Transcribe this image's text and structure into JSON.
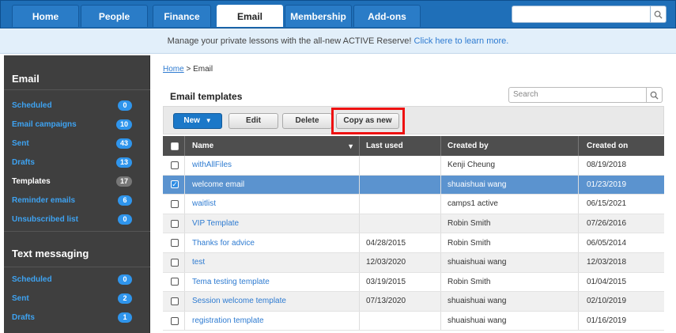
{
  "nav": {
    "tabs": [
      "Home",
      "People",
      "Finance",
      "Email",
      "Membership",
      "Add-ons"
    ],
    "active_tab": "Email",
    "search_value": ""
  },
  "banner": {
    "text": "Manage your private lessons with the all-new ACTIVE Reserve!",
    "link": "Click here to learn more."
  },
  "sidebar": {
    "email_heading": "Email",
    "email_items": [
      {
        "label": "Scheduled",
        "count": "0"
      },
      {
        "label": "Email campaigns",
        "count": "10"
      },
      {
        "label": "Sent",
        "count": "43"
      },
      {
        "label": "Drafts",
        "count": "13"
      },
      {
        "label": "Templates",
        "count": "17"
      },
      {
        "label": "Reminder emails",
        "count": "6"
      },
      {
        "label": "Unsubscribed list",
        "count": "0"
      }
    ],
    "text_heading": "Text messaging",
    "text_items": [
      {
        "label": "Scheduled",
        "count": "0"
      },
      {
        "label": "Sent",
        "count": "2"
      },
      {
        "label": "Drafts",
        "count": "1"
      }
    ]
  },
  "breadcrumb": {
    "home": "Home",
    "sep": ">",
    "current": "Email"
  },
  "main": {
    "title": "Email templates",
    "search_placeholder": "Search",
    "buttons": {
      "new": "New",
      "edit": "Edit",
      "delete": "Delete",
      "copy": "Copy as new"
    }
  },
  "table": {
    "headers": [
      "Name",
      "Last used",
      "Created by",
      "Created on"
    ],
    "rows": [
      {
        "name": "withAllFiles",
        "last_used": "",
        "created_by": "Kenji Cheung",
        "created_on": "08/19/2018",
        "checked": false
      },
      {
        "name": "welcome email",
        "last_used": "",
        "created_by": "shuaishuai wang",
        "created_on": "01/23/2019",
        "checked": true
      },
      {
        "name": "waitlist",
        "last_used": "",
        "created_by": "camps1 active",
        "created_on": "06/15/2021",
        "checked": false
      },
      {
        "name": "VIP Template",
        "last_used": "",
        "created_by": "Robin Smith",
        "created_on": "07/26/2016",
        "checked": false
      },
      {
        "name": "Thanks for advice",
        "last_used": "04/28/2015",
        "created_by": "Robin Smith",
        "created_on": "06/05/2014",
        "checked": false
      },
      {
        "name": "test",
        "last_used": "12/03/2020",
        "created_by": "shuaishuai wang",
        "created_on": "12/03/2018",
        "checked": false
      },
      {
        "name": "Tema testing template",
        "last_used": "03/19/2015",
        "created_by": "Robin Smith",
        "created_on": "01/04/2015",
        "checked": false
      },
      {
        "name": "Session welcome template",
        "last_used": "07/13/2020",
        "created_by": "shuaishuai wang",
        "created_on": "02/10/2019",
        "checked": false
      },
      {
        "name": "registration template",
        "last_used": "",
        "created_by": "shuaishuai wang",
        "created_on": "01/16/2019",
        "checked": false
      }
    ]
  }
}
